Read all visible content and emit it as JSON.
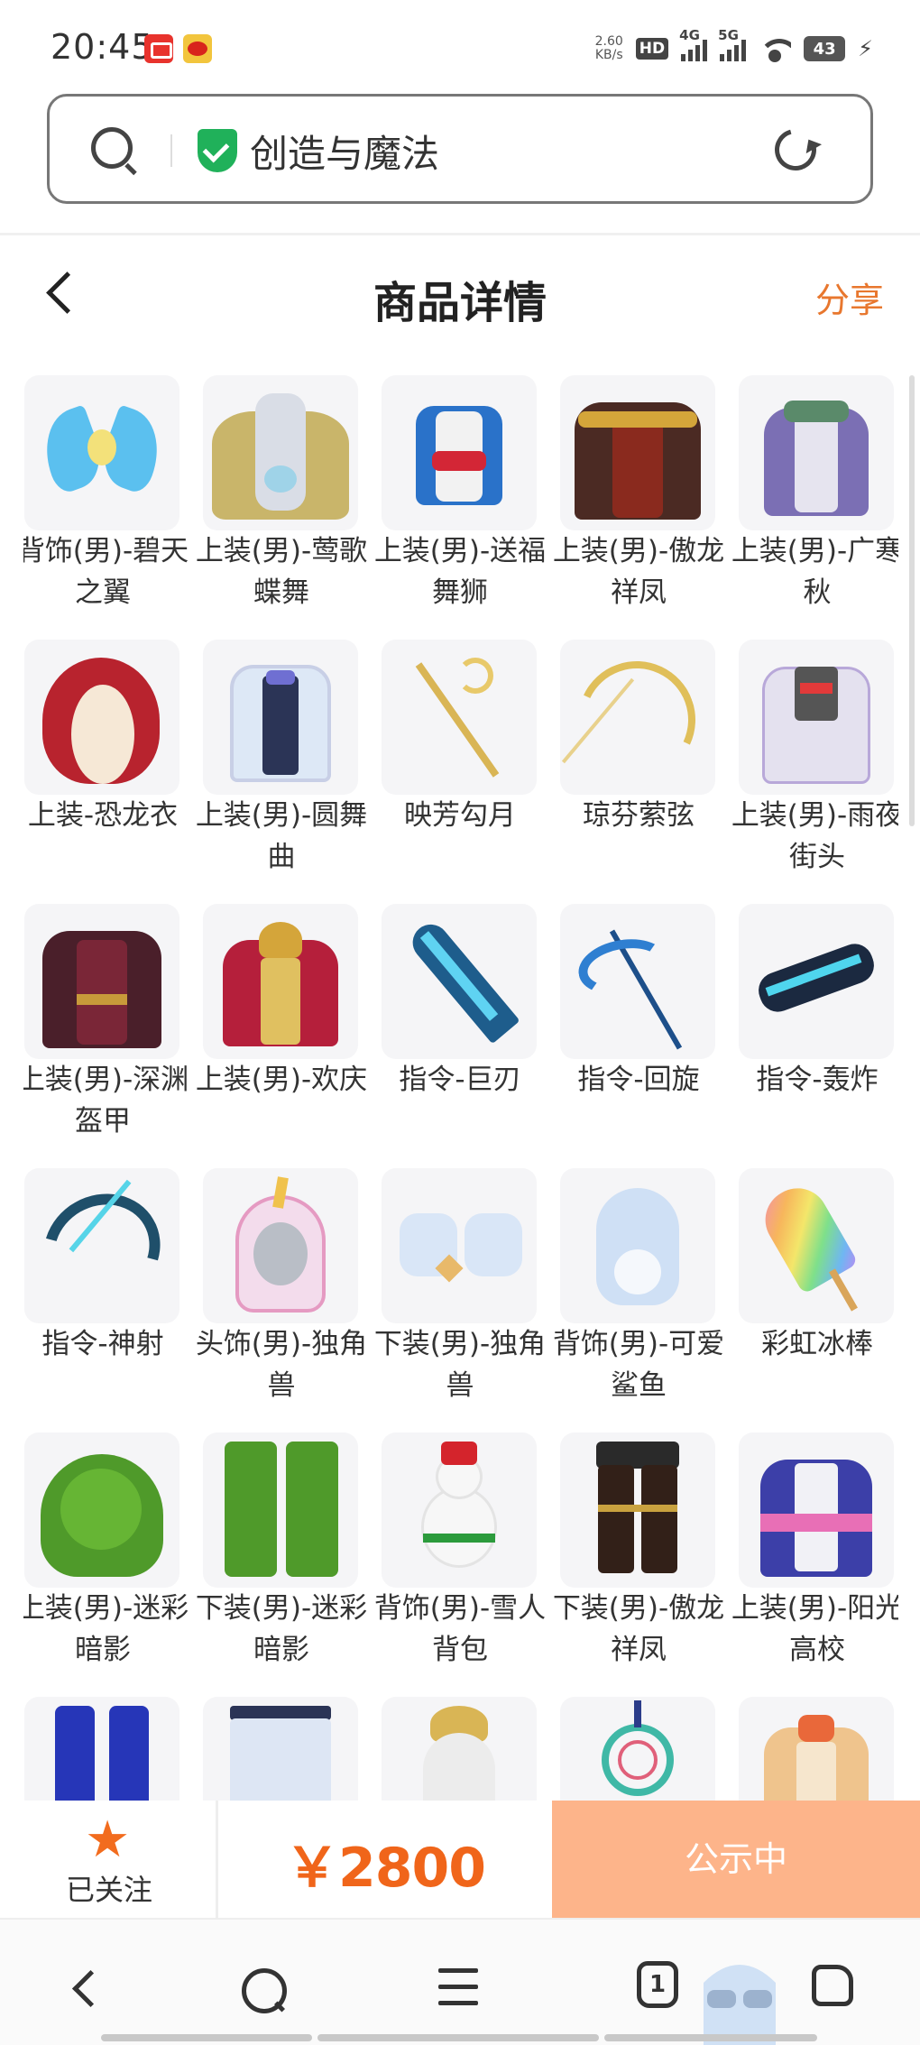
{
  "status_bar": {
    "time": "20:45",
    "net_speed_value": "2.60",
    "net_speed_unit": "KB/s",
    "hd_label": "HD",
    "signal_1": "4G",
    "signal_2": "5G",
    "battery": "43"
  },
  "search": {
    "query": "创造与魔法",
    "icon": "search-icon",
    "verified_icon": "shield-check-icon",
    "refresh_icon": "refresh-icon"
  },
  "nav": {
    "title": "商品详情",
    "share": "分享",
    "back_icon": "chevron-left-icon"
  },
  "items": [
    {
      "label": "背饰(男)-碧天之翼"
    },
    {
      "label": "上装(男)-莺歌蝶舞"
    },
    {
      "label": "上装(男)-送福舞狮"
    },
    {
      "label": "上装(男)-傲龙祥凤"
    },
    {
      "label": "上装(男)-广寒秋"
    },
    {
      "label": "上装-恐龙衣"
    },
    {
      "label": "上装(男)-圆舞曲"
    },
    {
      "label": "映芳勾月"
    },
    {
      "label": "琼芬萦弦"
    },
    {
      "label": "上装(男)-雨夜街头"
    },
    {
      "label": "上装(男)-深渊盔甲"
    },
    {
      "label": "上装(男)-欢庆"
    },
    {
      "label": "指令-巨刃"
    },
    {
      "label": "指令-回旋"
    },
    {
      "label": "指令-轰炸"
    },
    {
      "label": "指令-神射"
    },
    {
      "label": "头饰(男)-独角兽"
    },
    {
      "label": "下装(男)-独角兽"
    },
    {
      "label": "背饰(男)-可爱鲨鱼"
    },
    {
      "label": "彩虹冰棒"
    },
    {
      "label": "上装(男)-迷彩暗影"
    },
    {
      "label": "下装(男)-迷彩暗影"
    },
    {
      "label": "背饰(男)-雪人背包"
    },
    {
      "label": "下装(男)-傲龙祥凤"
    },
    {
      "label": "上装(男)-阳光高校"
    },
    {
      "label": ""
    },
    {
      "label": ""
    },
    {
      "label": ""
    },
    {
      "label": ""
    },
    {
      "label": ""
    }
  ],
  "action_bar": {
    "follow_label": "已关注",
    "follow_icon": "star-icon",
    "price": "￥2800",
    "status_button": "公示中"
  },
  "toolbar": {
    "tab_count": "1",
    "icons": [
      "back-icon",
      "search-icon",
      "menu-icon",
      "tabs-icon",
      "home-icon"
    ]
  },
  "colors": {
    "accent_orange": "#e8772e",
    "price_orange": "#f0651a",
    "status_button_bg": "#fdb48a",
    "verified_green": "#20b15a"
  }
}
